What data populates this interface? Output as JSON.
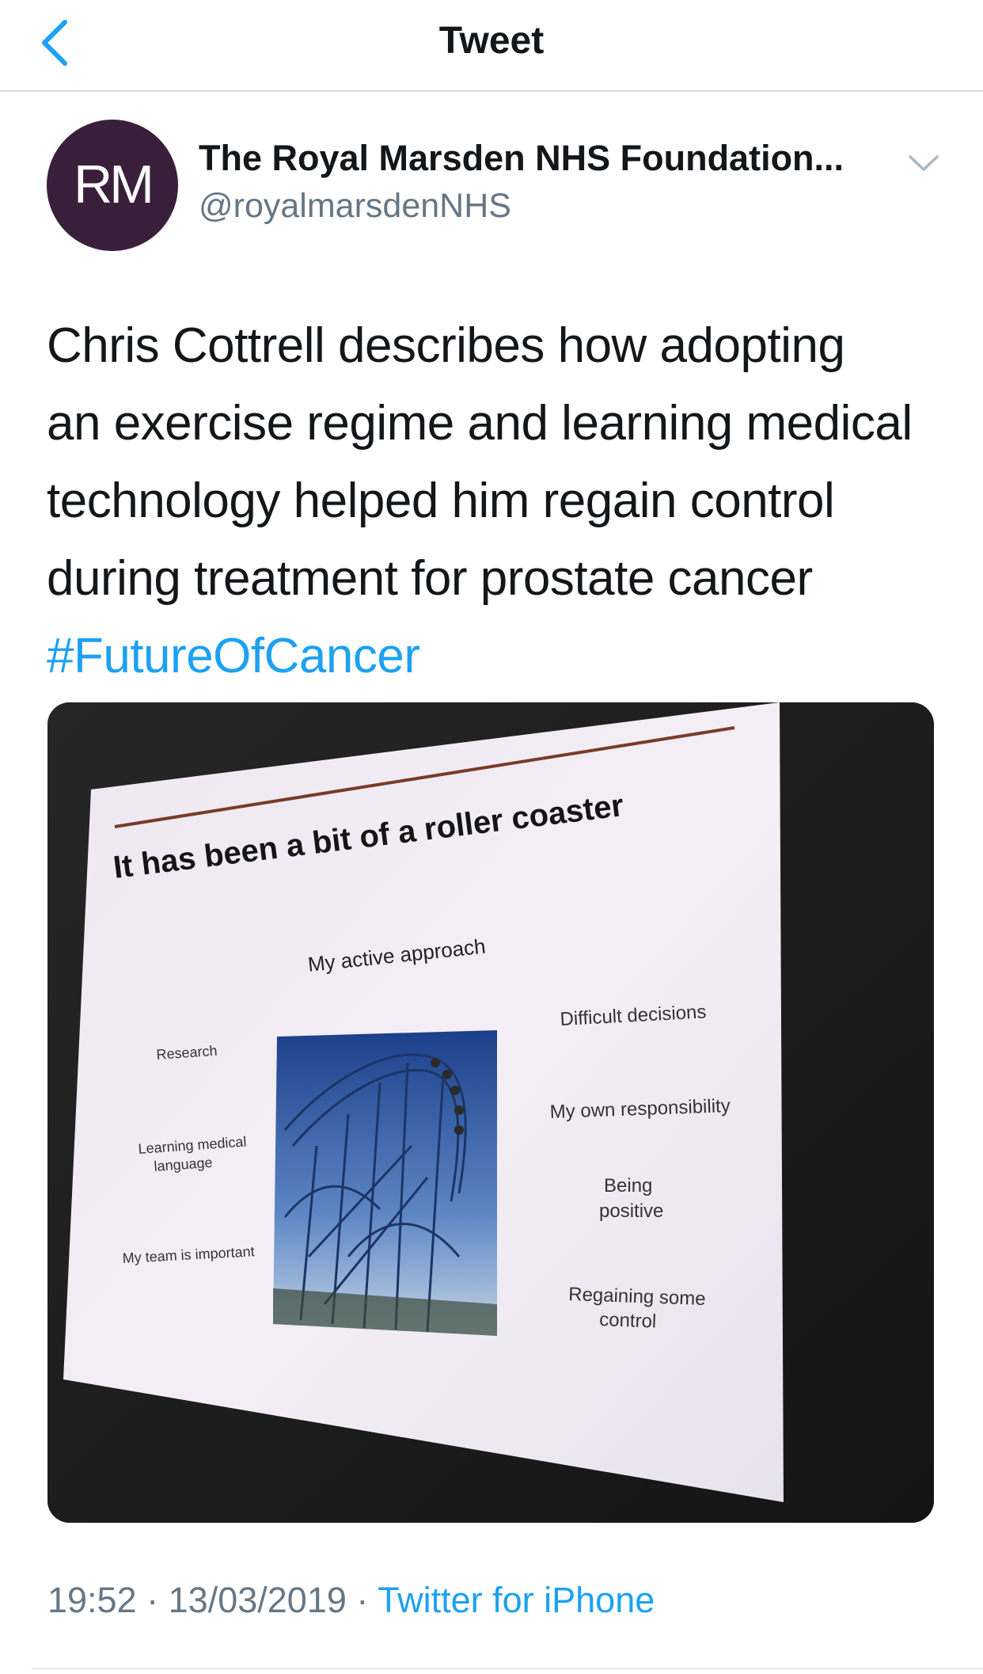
{
  "nav": {
    "title": "Tweet"
  },
  "author": {
    "avatar_initials": "RM",
    "name": "The Royal Marsden NHS Foundation...",
    "handle": "@royalmarsdenNHS"
  },
  "tweet": {
    "text_lines": [
      "Chris Cottrell describes how adopting",
      "an exercise regime and learning medical",
      "technology helped him regain control",
      "during treatment for prostate cancer"
    ],
    "hashtag": "#FutureOfCancer"
  },
  "slide": {
    "title": "It has been a bit of a roller coaster",
    "center_heading": "My active approach",
    "left_items": [
      "Research",
      "Learning medical",
      "language",
      "My team is important"
    ],
    "right_items": [
      "Difficult decisions",
      "My own responsibility",
      "Being",
      "positive",
      "Regaining some",
      "control"
    ]
  },
  "meta": {
    "time": "19:52",
    "date": "13/03/2019",
    "separator": "·",
    "source": "Twitter for iPhone"
  },
  "colors": {
    "accent": "#1da1f2",
    "secondary_text": "#657786",
    "avatar_bg": "#3a1f3b"
  }
}
